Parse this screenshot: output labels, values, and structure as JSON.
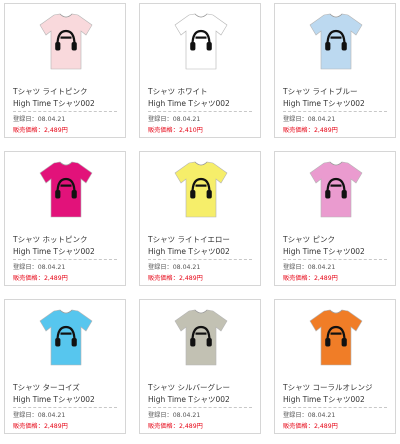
{
  "labels": {
    "date_label": "登録日：",
    "price_label": "販売価格："
  },
  "products": [
    {
      "color_name": "Tシャツ ライトピンク",
      "subtitle": "High Time Tシャツ002",
      "date": "08.04.21",
      "price": "2,489円",
      "shirt_color": "#f9d9dc"
    },
    {
      "color_name": "Tシャツ ホワイト",
      "subtitle": "High Time Tシャツ002",
      "date": "08.04.21",
      "price": "2,410円",
      "shirt_color": "#ffffff"
    },
    {
      "color_name": "Tシャツ ライトブルー",
      "subtitle": "High Time Tシャツ002",
      "date": "08.04.21",
      "price": "2,489円",
      "shirt_color": "#bcd9f0"
    },
    {
      "color_name": "Tシャツ ホットピンク",
      "subtitle": "High Time Tシャツ002",
      "date": "08.04.21",
      "price": "2,489円",
      "shirt_color": "#e2127a"
    },
    {
      "color_name": "Tシャツ ライトイエロー",
      "subtitle": "High Time Tシャツ002",
      "date": "08.04.21",
      "price": "2,489円",
      "shirt_color": "#f6ee6a"
    },
    {
      "color_name": "Tシャツ ピンク",
      "subtitle": "High Time Tシャツ002",
      "date": "08.04.21",
      "price": "2,489円",
      "shirt_color": "#ea9bcf"
    },
    {
      "color_name": "Tシャツ ターコイズ",
      "subtitle": "High Time Tシャツ002",
      "date": "08.04.21",
      "price": "2,489円",
      "shirt_color": "#57c6ee"
    },
    {
      "color_name": "Tシャツ シルバーグレー",
      "subtitle": "High Time Tシャツ002",
      "date": "08.04.21",
      "price": "2,489円",
      "shirt_color": "#c2c1b3"
    },
    {
      "color_name": "Tシャツ コーラルオレンジ",
      "subtitle": "High Time Tシャツ002",
      "date": "08.04.21",
      "price": "2,489円",
      "shirt_color": "#f07d27"
    }
  ]
}
